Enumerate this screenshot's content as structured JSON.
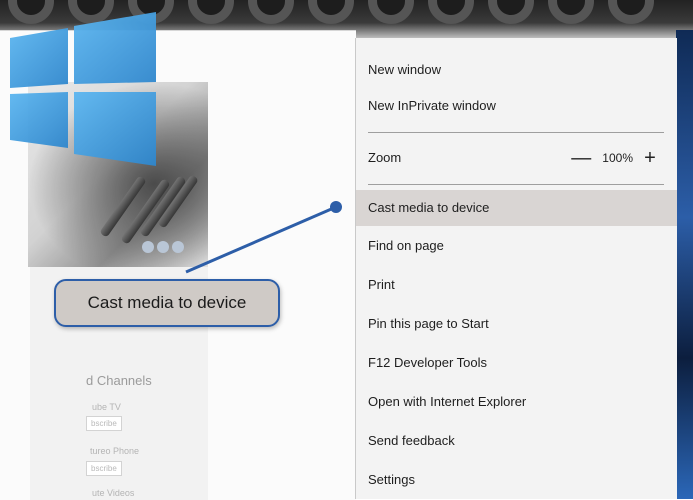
{
  "colors": {
    "accent": "#2d5ea8",
    "menu_background": "#f3f3f3",
    "menu_highlight": "#d9d5d3",
    "windows_logo": "#3f9ee0"
  },
  "page": {
    "channels_heading": "d Channels",
    "line1": "ube TV",
    "subscribe1": "bscribe",
    "line2": "tureo Phone",
    "subscribe2": "bscribe",
    "line3": "ute Videos"
  },
  "menu": {
    "items": [
      {
        "label": "New window"
      },
      {
        "label": "New InPrivate window"
      },
      {
        "label": "Zoom"
      },
      {
        "label": "Cast media to device"
      },
      {
        "label": "Find on page"
      },
      {
        "label": "Print"
      },
      {
        "label": "Pin this page to Start"
      },
      {
        "label": "F12 Developer Tools"
      },
      {
        "label": "Open with Internet Explorer"
      },
      {
        "label": "Send feedback"
      },
      {
        "label": "Settings"
      }
    ],
    "zoom": {
      "decrease_symbol": "—",
      "value": "100%",
      "increase_symbol": "+"
    },
    "highlighted": "Cast media to device"
  },
  "callout": {
    "text": "Cast media to device"
  },
  "icons": {
    "logo": "windows-logo-icon",
    "social": [
      "pinterest-icon",
      "facebook-icon",
      "twitter-icon"
    ]
  }
}
